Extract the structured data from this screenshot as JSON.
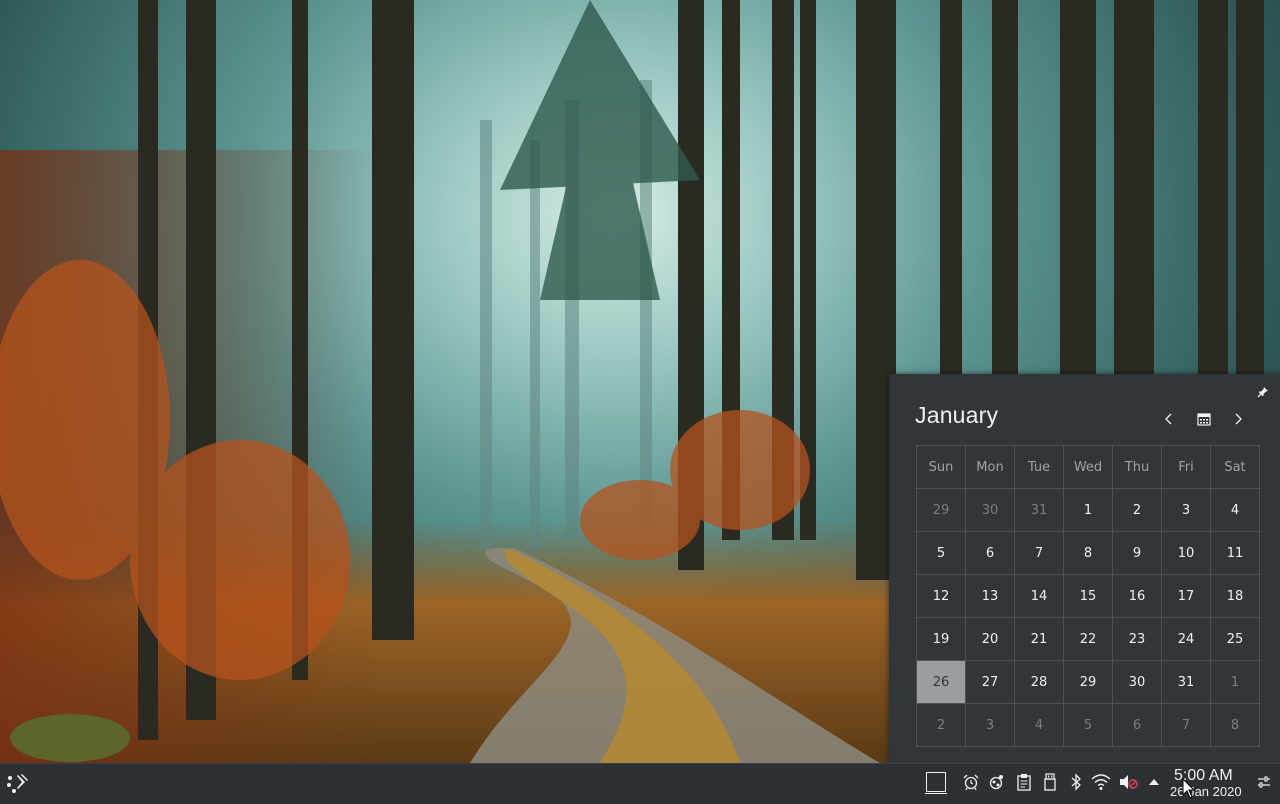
{
  "calendar": {
    "month": "January",
    "weekdays": [
      "Sun",
      "Mon",
      "Tue",
      "Wed",
      "Thu",
      "Fri",
      "Sat"
    ],
    "weeks": [
      [
        "29",
        "30",
        "31",
        "1",
        "2",
        "3",
        "4"
      ],
      [
        "5",
        "6",
        "7",
        "8",
        "9",
        "10",
        "11"
      ],
      [
        "12",
        "13",
        "14",
        "15",
        "16",
        "17",
        "18"
      ],
      [
        "19",
        "20",
        "21",
        "22",
        "23",
        "24",
        "25"
      ],
      [
        "26",
        "27",
        "28",
        "29",
        "30",
        "31",
        "1"
      ],
      [
        "2",
        "3",
        "4",
        "5",
        "6",
        "7",
        "8"
      ]
    ],
    "today": "26",
    "prev_icon": "chevron-left-icon",
    "today_icon": "calendar-icon",
    "next_icon": "chevron-right-icon",
    "pin_icon": "pin-icon"
  },
  "panel": {
    "launcher_icon": "application-launcher-icon",
    "tray_icons": [
      "show-desktop-icon",
      "alarm-icon",
      "kde-connect-icon",
      "clipboard-icon",
      "usb-device-icon",
      "bluetooth-icon",
      "wifi-icon",
      "volume-muted-icon",
      "expand-tray-icon"
    ],
    "clock_time": "5:00 AM",
    "clock_date": "26 Jan 2020",
    "panel_settings_icon": "panel-settings-icon"
  },
  "colors": {
    "panel_bg": "#2d3136",
    "popup_bg": "#31363b",
    "today_highlight": "#9b9ea1",
    "text": "#eff0f1"
  }
}
